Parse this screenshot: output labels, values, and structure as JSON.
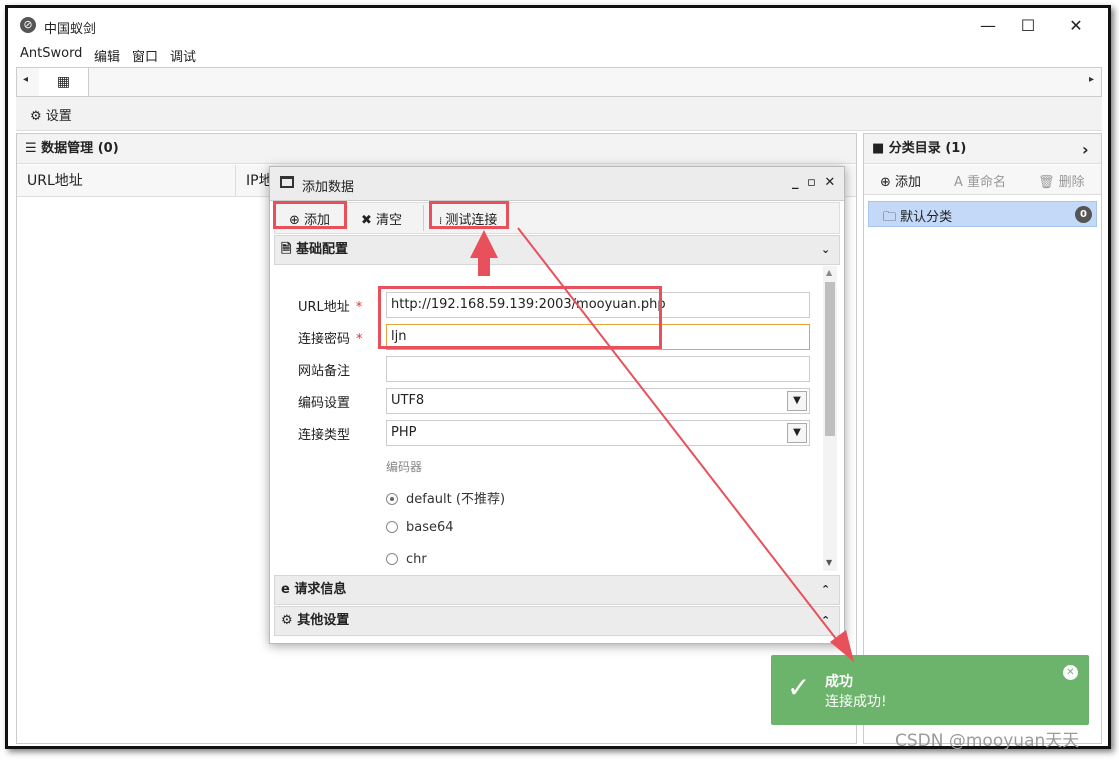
{
  "window": {
    "title": "中国蚁剑",
    "controls": {
      "minimize": "—",
      "maximize": "☐",
      "close": "✕"
    }
  },
  "menu": [
    "AntSword",
    "编辑",
    "窗口",
    "调试"
  ],
  "tabs": {
    "left_arrow": "◂",
    "right_arrow": "▸",
    "home_icon": "grid-icon",
    "home_glyph": "▦"
  },
  "settings_bar": {
    "label": "⚙ 设置"
  },
  "data_panel": {
    "header": "☰ 数据管理 (0)",
    "columns": [
      "URL地址",
      "IP地"
    ]
  },
  "category_panel": {
    "header": "■ 分类目录 (1)",
    "expand": "›",
    "toolbar": {
      "add": "⊕ 添加",
      "rename": "A 重命名",
      "delete": "🗑 删除"
    },
    "items": [
      {
        "label": "🗀 默认分类",
        "count": "0"
      }
    ]
  },
  "dialog": {
    "title": "添加数据",
    "title_controls": "_ ▫ ✕",
    "toolbar": {
      "add": "⊕ 添加",
      "clear": "✖ 清空",
      "test": "测试连接"
    },
    "sections": {
      "basic": "基础配置",
      "request": "请求信息",
      "other": "其他设置"
    },
    "form": {
      "url_label": "URL地址",
      "url_value": "http://192.168.59.139:2003/mooyuan.php",
      "password_label": "连接密码",
      "password_value": "ljn",
      "note_label": "网站备注",
      "note_value": "",
      "encoding_label": "编码设置",
      "encoding_value": "UTF8",
      "type_label": "连接类型",
      "type_value": "PHP",
      "encoder_label": "编码器",
      "encoders": [
        {
          "label": "default (不推荐)",
          "selected": true
        },
        {
          "label": "base64",
          "selected": false
        },
        {
          "label": "chr",
          "selected": false
        }
      ]
    }
  },
  "toast": {
    "title": "成功",
    "message": "连接成功!",
    "color": "#6cb36c"
  },
  "watermark": "CSDN @mooyuan天天",
  "annotation_color": "#e8505b"
}
